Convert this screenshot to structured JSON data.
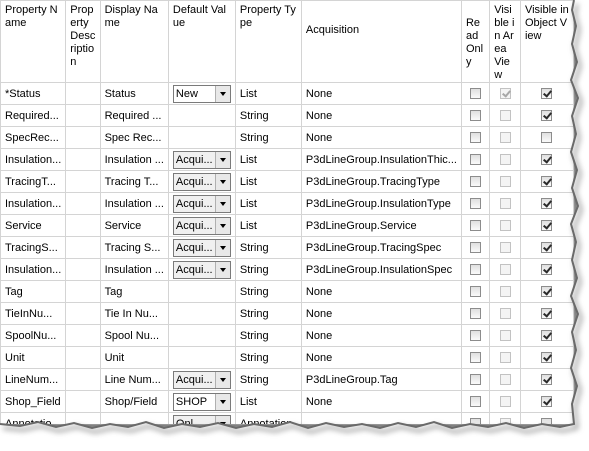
{
  "headers": {
    "property_name": "Property Name",
    "property_description": "Property Description",
    "display_name": "Display Name",
    "default_value": "Default Value",
    "property_type": "Property Type",
    "acquisition": "Acquisition",
    "read_only": "Read Only",
    "visible_area_view": "Visible in Area View",
    "visible_object_view": "Visible in Object View"
  },
  "rows": [
    {
      "name": "*Status",
      "desc": "",
      "display": "Status",
      "default": "New",
      "default_combo": true,
      "type": "List",
      "acq": "None",
      "ro": false,
      "area": true,
      "area_dis": true,
      "obj": true
    },
    {
      "name": "Required...",
      "desc": "",
      "display": "Required ...",
      "default": "",
      "default_combo": false,
      "type": "String",
      "acq": "None",
      "ro": false,
      "area": false,
      "area_dis": false,
      "obj": true
    },
    {
      "name": "SpecRec...",
      "desc": "",
      "display": "Spec Rec...",
      "default": "",
      "default_combo": false,
      "type": "String",
      "acq": "None",
      "ro": false,
      "area": false,
      "area_dis": false,
      "obj": false
    },
    {
      "name": "Insulation...",
      "desc": "",
      "display": "Insulation ...",
      "default": "Acqui...",
      "default_combo": true,
      "type": "List",
      "acq": "P3dLineGroup.InsulationThic...",
      "ro": false,
      "area": false,
      "area_dis": false,
      "obj": true
    },
    {
      "name": "TracingT...",
      "desc": "",
      "display": "Tracing T...",
      "default": "Acqui...",
      "default_combo": true,
      "type": "List",
      "acq": "P3dLineGroup.TracingType",
      "ro": false,
      "area": false,
      "area_dis": false,
      "obj": true
    },
    {
      "name": "Insulation...",
      "desc": "",
      "display": "Insulation ...",
      "default": "Acqui...",
      "default_combo": true,
      "type": "List",
      "acq": "P3dLineGroup.InsulationType",
      "ro": false,
      "area": false,
      "area_dis": false,
      "obj": true
    },
    {
      "name": "Service",
      "desc": "",
      "display": "Service",
      "default": "Acqui...",
      "default_combo": true,
      "type": "List",
      "acq": "P3dLineGroup.Service",
      "ro": false,
      "area": false,
      "area_dis": false,
      "obj": true
    },
    {
      "name": "TracingS...",
      "desc": "",
      "display": "Tracing S...",
      "default": "Acqui...",
      "default_combo": true,
      "type": "String",
      "acq": "P3dLineGroup.TracingSpec",
      "ro": false,
      "area": false,
      "area_dis": false,
      "obj": true
    },
    {
      "name": "Insulation...",
      "desc": "",
      "display": "Insulation ...",
      "default": "Acqui...",
      "default_combo": true,
      "type": "String",
      "acq": "P3dLineGroup.InsulationSpec",
      "ro": false,
      "area": false,
      "area_dis": false,
      "obj": true
    },
    {
      "name": "Tag",
      "desc": "",
      "display": "Tag",
      "default": "",
      "default_combo": false,
      "type": "String",
      "acq": "None",
      "ro": false,
      "area": false,
      "area_dis": false,
      "obj": true
    },
    {
      "name": "TieInNu...",
      "desc": "",
      "display": "Tie In Nu...",
      "default": "",
      "default_combo": false,
      "type": "String",
      "acq": "None",
      "ro": false,
      "area": false,
      "area_dis": false,
      "obj": true
    },
    {
      "name": "SpoolNu...",
      "desc": "",
      "display": "Spool Nu...",
      "default": "",
      "default_combo": false,
      "type": "String",
      "acq": "None",
      "ro": false,
      "area": false,
      "area_dis": false,
      "obj": true
    },
    {
      "name": "Unit",
      "desc": "",
      "display": "Unit",
      "default": "",
      "default_combo": false,
      "type": "String",
      "acq": "None",
      "ro": false,
      "area": false,
      "area_dis": false,
      "obj": true
    },
    {
      "name": "LineNum...",
      "desc": "",
      "display": "Line Num...",
      "default": "Acqui...",
      "default_combo": true,
      "type": "String",
      "acq": "P3dLineGroup.Tag",
      "ro": false,
      "area": false,
      "area_dis": false,
      "obj": true
    },
    {
      "name": "Shop_Field",
      "desc": "",
      "display": "Shop/Field",
      "default": "SHOP",
      "default_combo": true,
      "type": "List",
      "acq": "None",
      "ro": false,
      "area": false,
      "area_dis": false,
      "obj": true
    },
    {
      "name": "Annotatio...",
      "desc": "",
      "display": "",
      "default": "Onl...",
      "default_combo": true,
      "type": "Annotation",
      "acq": "",
      "ro": false,
      "area": false,
      "area_dis": false,
      "obj": false
    }
  ]
}
